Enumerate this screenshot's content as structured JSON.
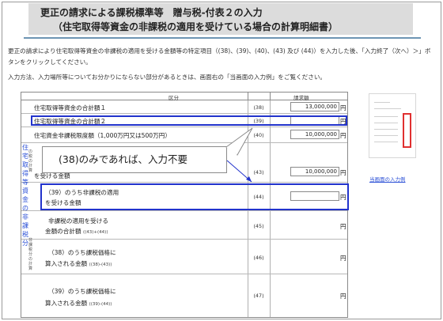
{
  "title": {
    "line1": "更正の請求による課税標準等　贈与税-付表２の入力",
    "line2": "（住宅取得等資金の非課税の適用を受けている場合の計算明細書）"
  },
  "intro": "更正の請求により住宅取得等資金の非課税の適用を受ける金額等の特定項目（(38)、(39)、(40)、(43) 及び (44)）を入力した後、「入力終了（次へ）＞」ボタンをクリックしてください。",
  "note": "入力方法、入力場所等についてお分かりにならない部分があるときは、画面右の「当画面の入力例」をご覧ください。",
  "table": {
    "header_kubun": "区分",
    "header_seikyu": "請求額",
    "yen": "円",
    "side_label": "住宅取得等資金の非課税分",
    "side_sub1": "の税の計算",
    "side_sub2": "非課税分の計算",
    "rows": [
      {
        "label": "住宅取得等資金の合計額１",
        "num": "(38)",
        "value": "13,000,000"
      },
      {
        "label": "住宅取得等資金の合計額２",
        "num": "(39)",
        "value": ""
      },
      {
        "label": "住宅資金非課税限度額（1,000万円又は500万円）",
        "num": "(40)",
        "value": "10,000,000"
      },
      {
        "label": "を受ける金額",
        "num": "(43)",
        "value": "10,000,000"
      },
      {
        "label": "（39）のうち非課税の適用",
        "label2": "を受ける金額",
        "num": "(44)",
        "value": ""
      },
      {
        "label": "非課税の適用を受ける",
        "label2": "金額の合計額",
        "small": "((43)+(44))",
        "num": "(45)"
      },
      {
        "label": "（38）のうち課税価格に",
        "label2": "算入される金額",
        "small": "((38)-(43))",
        "num": "(46)"
      },
      {
        "label": "（39）のうち課税価格に",
        "label2": "算入される金額",
        "small": "((39)-(44))",
        "num": "(47)"
      }
    ]
  },
  "callout": "(38)のみであれば、入力不要",
  "example_link": "当画面の入力例",
  "colors": {
    "highlight": "#2233cc",
    "link": "#2a4fd6",
    "rule": "#6d95b3",
    "title_bg": "#dcdcdc"
  }
}
